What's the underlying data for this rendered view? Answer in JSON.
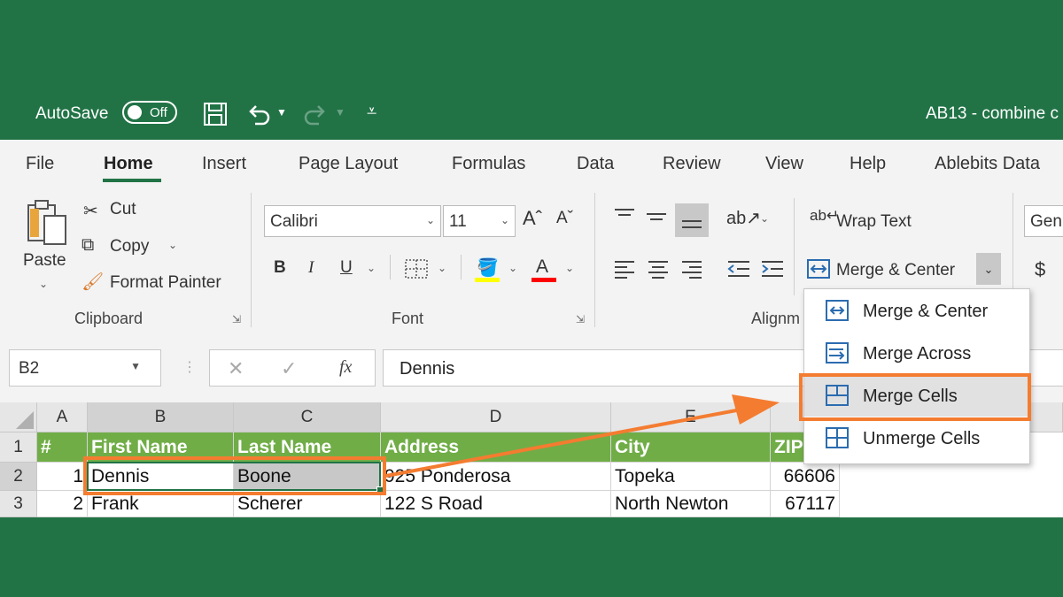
{
  "titlebar": {
    "autosave_label": "AutoSave",
    "autosave_state": "Off",
    "doc_title": "AB13 - combine c"
  },
  "tabs": [
    "File",
    "Home",
    "Insert",
    "Page Layout",
    "Formulas",
    "Data",
    "Review",
    "View",
    "Help",
    "Ablebits Data"
  ],
  "ribbon": {
    "clipboard": {
      "paste_label": "Paste",
      "cut_label": "Cut",
      "copy_label": "Copy",
      "format_painter_label": "Format Painter",
      "group_label": "Clipboard"
    },
    "font": {
      "font_name": "Calibri",
      "font_size": "11",
      "bold": "B",
      "italic": "I",
      "underline": "U",
      "group_label": "Font"
    },
    "alignment": {
      "wrap_text_label": "Wrap Text",
      "merge_center_label": "Merge & Center",
      "group_label": "Alignm"
    },
    "number": {
      "format_value": "Gen",
      "currency_symbol": "$"
    }
  },
  "formula_bar": {
    "name_box": "B2",
    "fx_label": "fx",
    "value": "Dennis"
  },
  "grid": {
    "columns": [
      "A",
      "B",
      "C",
      "D",
      "E"
    ],
    "header_row": [
      "#",
      "First Name",
      "Last Name",
      "Address",
      "City",
      "ZIP"
    ],
    "rows": [
      {
        "row": "2",
        "num": "1",
        "first": "Dennis",
        "last": "Boone",
        "address": "925 Ponderosa",
        "city": "Topeka",
        "zip": "66606"
      },
      {
        "row": "3",
        "num": "2",
        "first": "Frank",
        "last": "Scherer",
        "address": "122 S Road",
        "city": "North Newton",
        "zip": "67117"
      }
    ],
    "row1_label": "1"
  },
  "merge_menu": {
    "items": [
      "Merge & Center",
      "Merge Across",
      "Merge Cells",
      "Unmerge Cells"
    ],
    "selected_index": 2
  },
  "colors": {
    "excel_green": "#217346",
    "header_green": "#70ad47",
    "highlight_orange": "#f47c30",
    "menu_icon_blue": "#2b6cb0"
  }
}
